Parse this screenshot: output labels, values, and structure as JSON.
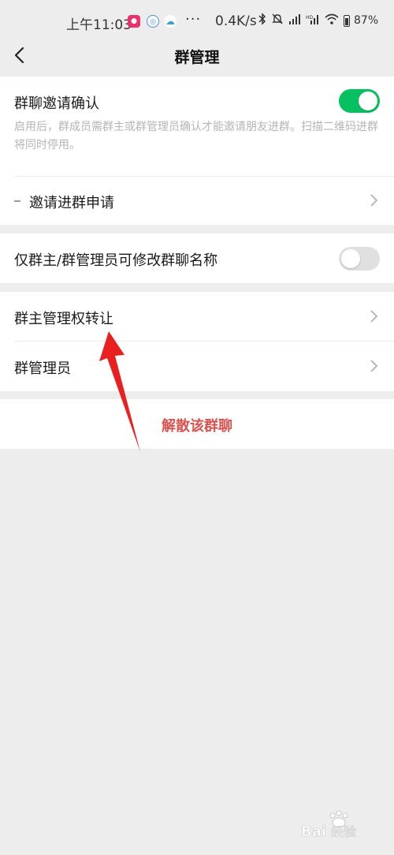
{
  "status_bar": {
    "time": "上午11:03",
    "more": "···",
    "net_speed": "0.4K/s",
    "battery": "87%"
  },
  "nav": {
    "title": "群管理"
  },
  "settings": {
    "invite_confirm": {
      "label": "群聊邀请确认",
      "desc": "启用后，群成员需群主或群管理员确认才能邀请朋友进群。扫描二维码进群将同时停用。",
      "enabled": true
    },
    "invite_requests": {
      "label": "邀请进群申请"
    },
    "only_admin_rename": {
      "label": "仅群主/群管理员可修改群聊名称",
      "enabled": false
    },
    "transfer_owner": {
      "label": "群主管理权转让"
    },
    "admins": {
      "label": "群管理员"
    },
    "dissolve": {
      "label": "解散该群聊"
    }
  },
  "colors": {
    "toggle_on": "#07c160",
    "danger": "#d9534f",
    "annotation_arrow": "#e8201f"
  },
  "watermark": {
    "text": "Bai经验"
  }
}
